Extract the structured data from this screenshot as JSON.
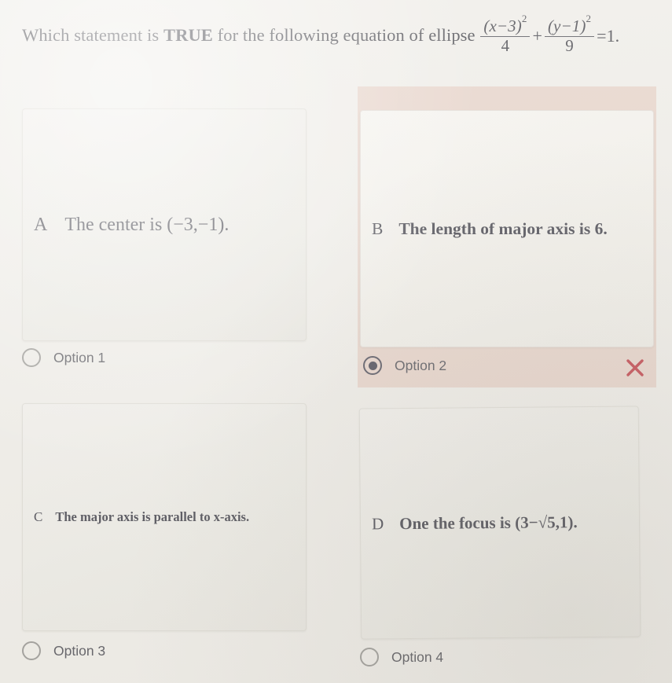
{
  "question": {
    "prefix": "Which statement is ",
    "emphasis": "TRUE",
    "suffix": " for the following equation of ellipse ",
    "equation": {
      "term1": {
        "numerator_base": "(x−3)",
        "numerator_exp": "2",
        "denominator": "4"
      },
      "operator": "+",
      "term2": {
        "numerator_base": "(y−1)",
        "numerator_exp": "2",
        "denominator": "9"
      },
      "equals": "=1."
    }
  },
  "options": [
    {
      "letter": "A",
      "statement": "The center is (−3,−1).",
      "radio_label": "Option 1",
      "selected": false,
      "highlighted": false,
      "marker": ""
    },
    {
      "letter": "B",
      "statement": "The length of major axis is 6.",
      "radio_label": "Option 2",
      "selected": true,
      "highlighted": true,
      "marker": "cross-icon"
    },
    {
      "letter": "C",
      "statement": "The major axis is parallel to x-axis.",
      "radio_label": "Option 3",
      "selected": false,
      "highlighted": false,
      "marker": ""
    },
    {
      "letter": "D",
      "statement": "One the focus is (3−√5,1).",
      "radio_label": "Option 4",
      "selected": false,
      "highlighted": false,
      "marker": ""
    }
  ],
  "colors": {
    "page_background": "#efede8",
    "card_background": "#ecebe5",
    "highlight_background": "#e7d4ca",
    "text": "#474750",
    "radio_unselected": "#9b9a96",
    "radio_selected": "#4d4c58",
    "wrong_mark": "#c0434b"
  }
}
